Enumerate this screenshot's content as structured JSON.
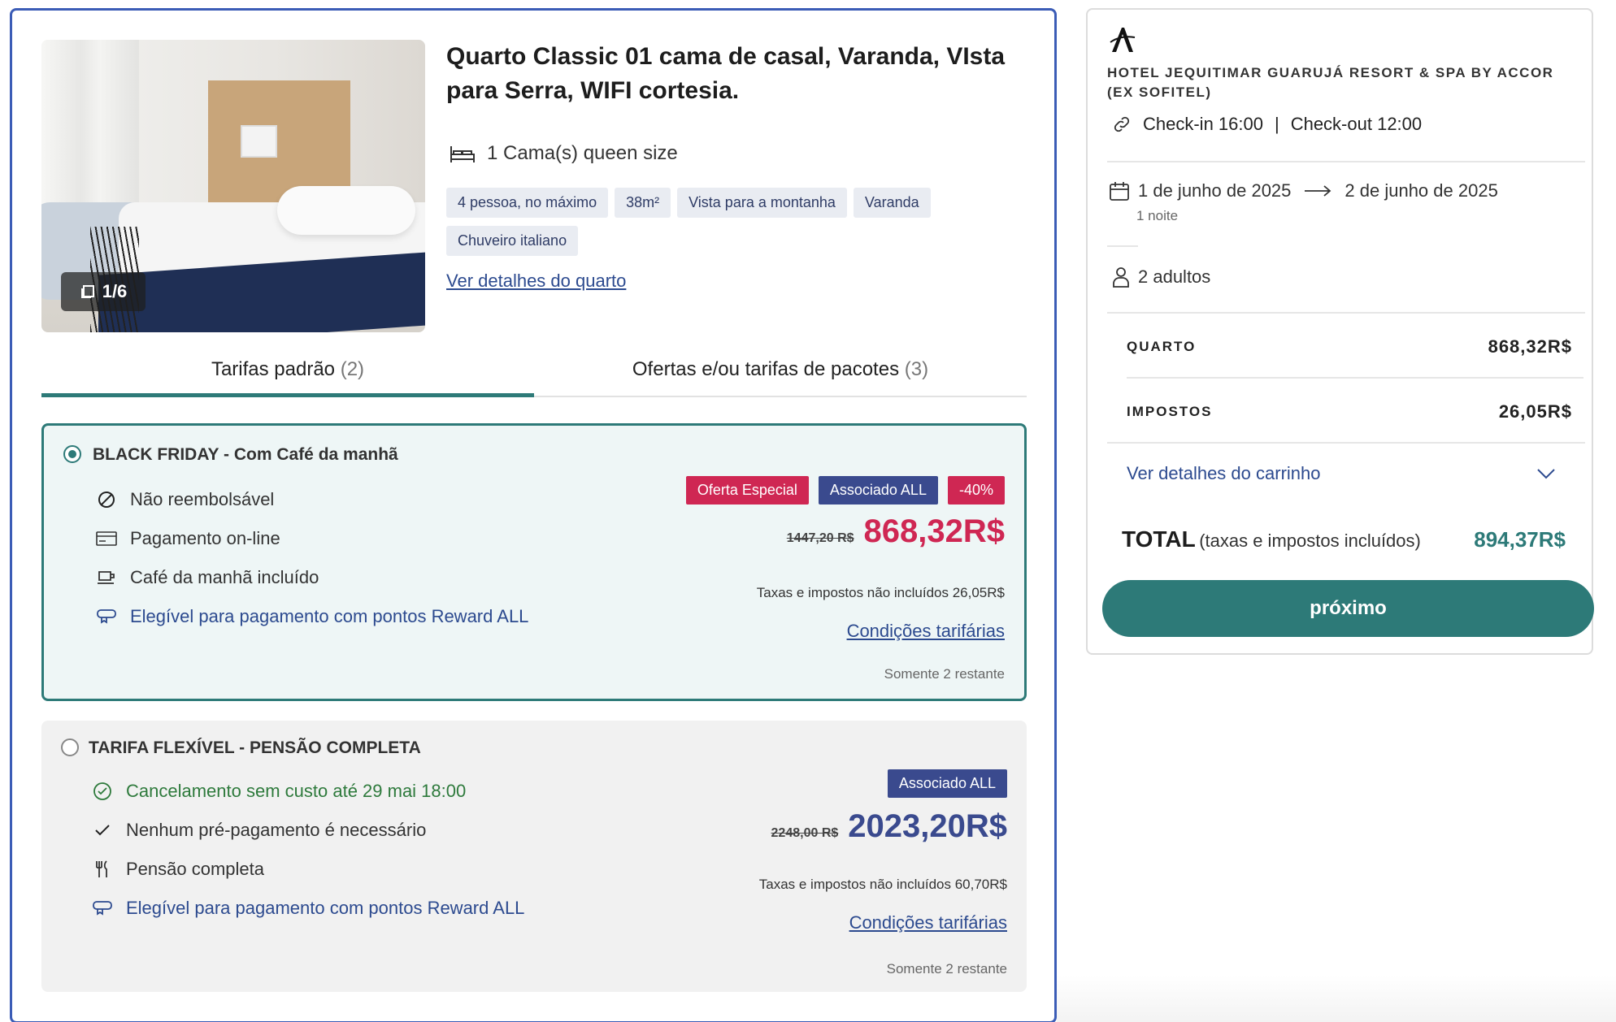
{
  "room": {
    "title": "Quarto Classic 01 cama de casal, Varanda, VIsta para Serra, WIFI cortesia.",
    "photo_counter": "1/6",
    "beds": "1 Cama(s) queen size",
    "tags": [
      "4 pessoa, no máximo",
      "38m²",
      "Vista para a montanha",
      "Varanda",
      "Chuveiro italiano"
    ],
    "details_link": "Ver detalhes do quarto"
  },
  "tabs": [
    {
      "label": "Tarifas padrão",
      "count": "(2)",
      "active": true
    },
    {
      "label": "Ofertas e/ou tarifas de pacotes",
      "count": "(3)",
      "active": false
    }
  ],
  "rates": [
    {
      "title": "BLACK FRIDAY - Com Café da manhã",
      "selected": true,
      "features": [
        "Não reembolsável",
        "Pagamento on-line",
        "Café da manhã incluído",
        "Elegível para pagamento com pontos Reward ALL"
      ],
      "badges": [
        "Oferta Especial",
        "Associado ALL",
        "-40%"
      ],
      "old_price": "1447,20 R$",
      "price": "868,32R$",
      "taxes": "Taxas e impostos não incluídos 26,05R$",
      "conditions_link": "Condições tarifárias",
      "remaining": "Somente 2 restante"
    },
    {
      "title": "TARIFA FLEXÍVEL - PENSÃO COMPLETA",
      "selected": false,
      "features": [
        "Cancelamento sem custo até 29 mai 18:00",
        "Nenhum pré-pagamento é necessário",
        "Pensão completa",
        "Elegível para pagamento com pontos Reward ALL"
      ],
      "badges": [
        "Associado ALL"
      ],
      "old_price": "2248,00 R$",
      "price": "2023,20R$",
      "taxes": "Taxas e impostos não incluídos 60,70R$",
      "conditions_link": "Condições tarifárias",
      "remaining": "Somente 2 restante"
    }
  ],
  "summary": {
    "hotel_name": "HOTEL JEQUITIMAR GUARUJÁ RESORT & SPA BY ACCOR (EX SOFITEL)",
    "checkin": "Check-in 16:00",
    "separator": "|",
    "checkout": "Check-out 12:00",
    "date_from": "1 de junho de 2025",
    "date_to": "2 de junho de 2025",
    "nights": "1 noite",
    "guests": "2 adultos",
    "room_label": "QUARTO",
    "room_value": "868,32R$",
    "taxes_label": "IMPOSTOS",
    "taxes_value": "26,05R$",
    "cart_link": "Ver detalhes do carrinho",
    "total_label": "TOTAL",
    "total_sub": "(taxas e impostos incluídos)",
    "total_value": "894,37R$",
    "next_button": "próximo"
  },
  "colors": {
    "accent": "#2d7a78",
    "brand_blue": "#3b5cb6",
    "price_red": "#cf2753",
    "navy": "#3a4a8e",
    "link": "#2c4a8f"
  },
  "icons": [
    "gallery-icon",
    "bed-icon",
    "no-refund-icon",
    "card-icon",
    "coffee-icon",
    "reward-icon",
    "check-circle-icon",
    "check-icon",
    "fork-knife-icon",
    "link-icon",
    "calendar-icon",
    "arrow-right-icon",
    "person-icon",
    "chevron-down-icon",
    "accor-logo"
  ]
}
